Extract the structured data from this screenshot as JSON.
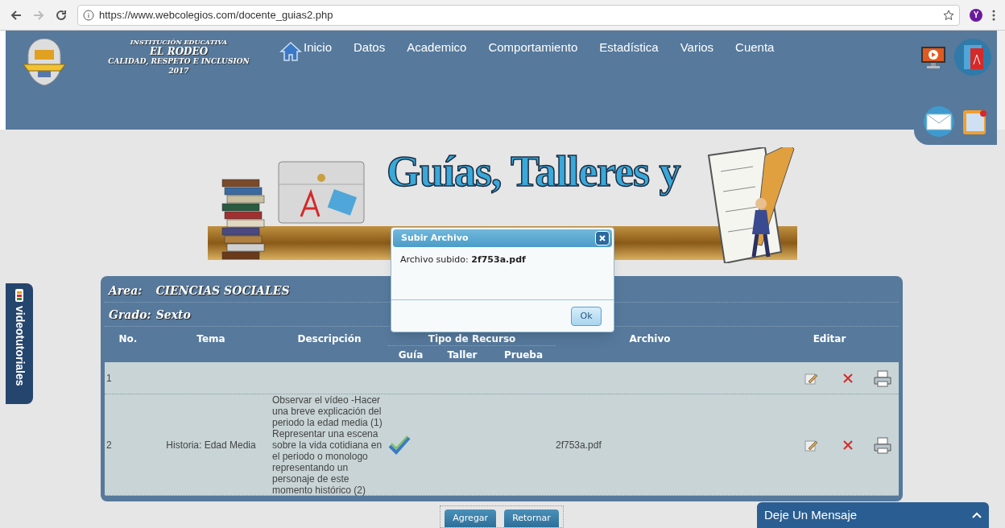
{
  "browser": {
    "url": "https://www.webcolegios.com/docente_guias2.php",
    "profile": "Y"
  },
  "header": {
    "school": [
      "INSTITUCIÓN EDUCATIVA",
      "EL RODEO",
      "CALIDAD, RESPETO E INCLUSION",
      "2017"
    ],
    "nav": [
      {
        "label": "Inicio",
        "kind": "home"
      },
      {
        "label": "Datos",
        "kind": "plain"
      },
      {
        "label": "Academico",
        "kind": "plain"
      },
      {
        "label": "Comportamiento",
        "kind": "plain"
      },
      {
        "label": "Estadística",
        "kind": "plain"
      },
      {
        "label": "Varios",
        "kind": "plain"
      },
      {
        "label": "Cuenta",
        "kind": "plain"
      }
    ]
  },
  "banner": {
    "title": "Guías, Talleres y"
  },
  "side_tab": {
    "label": "videotutoriales"
  },
  "panel": {
    "area_label": "Area:",
    "area": "CIENCIAS SOCIALES",
    "grado_label": "Grado:",
    "grado": "Sexto",
    "columns": {
      "no": "No.",
      "tema": "Tema",
      "descripcion": "Descripción",
      "tipo": "Tipo de Recurso",
      "guia": "Guía",
      "taller": "Taller",
      "prueba": "Prueba",
      "archivo": "Archivo",
      "editar": "Editar"
    },
    "rows": [
      {
        "no": "1",
        "tema": "",
        "descripcion": "",
        "guia": false,
        "taller": false,
        "prueba": false,
        "archivo": ""
      },
      {
        "no": "2",
        "tema": "Historia: Edad Media",
        "descripcion": "Observar el vídeo -Hacer una breve explicación del periodo la edad media (1) Representar una escena sobre la vida cotidiana en el periodo o monologo representando un personaje de este momento histórico (2)",
        "guia": true,
        "taller": false,
        "prueba": false,
        "archivo": "2f753a.pdf"
      }
    ]
  },
  "buttons": [
    "Agregar",
    "Retornar"
  ],
  "dialog": {
    "title": "Subir Archivo",
    "message": "Archivo subido: **2f753a.pdf**",
    "ok": "Ok"
  },
  "chat": {
    "label": "Deje Un Mensaje"
  }
}
